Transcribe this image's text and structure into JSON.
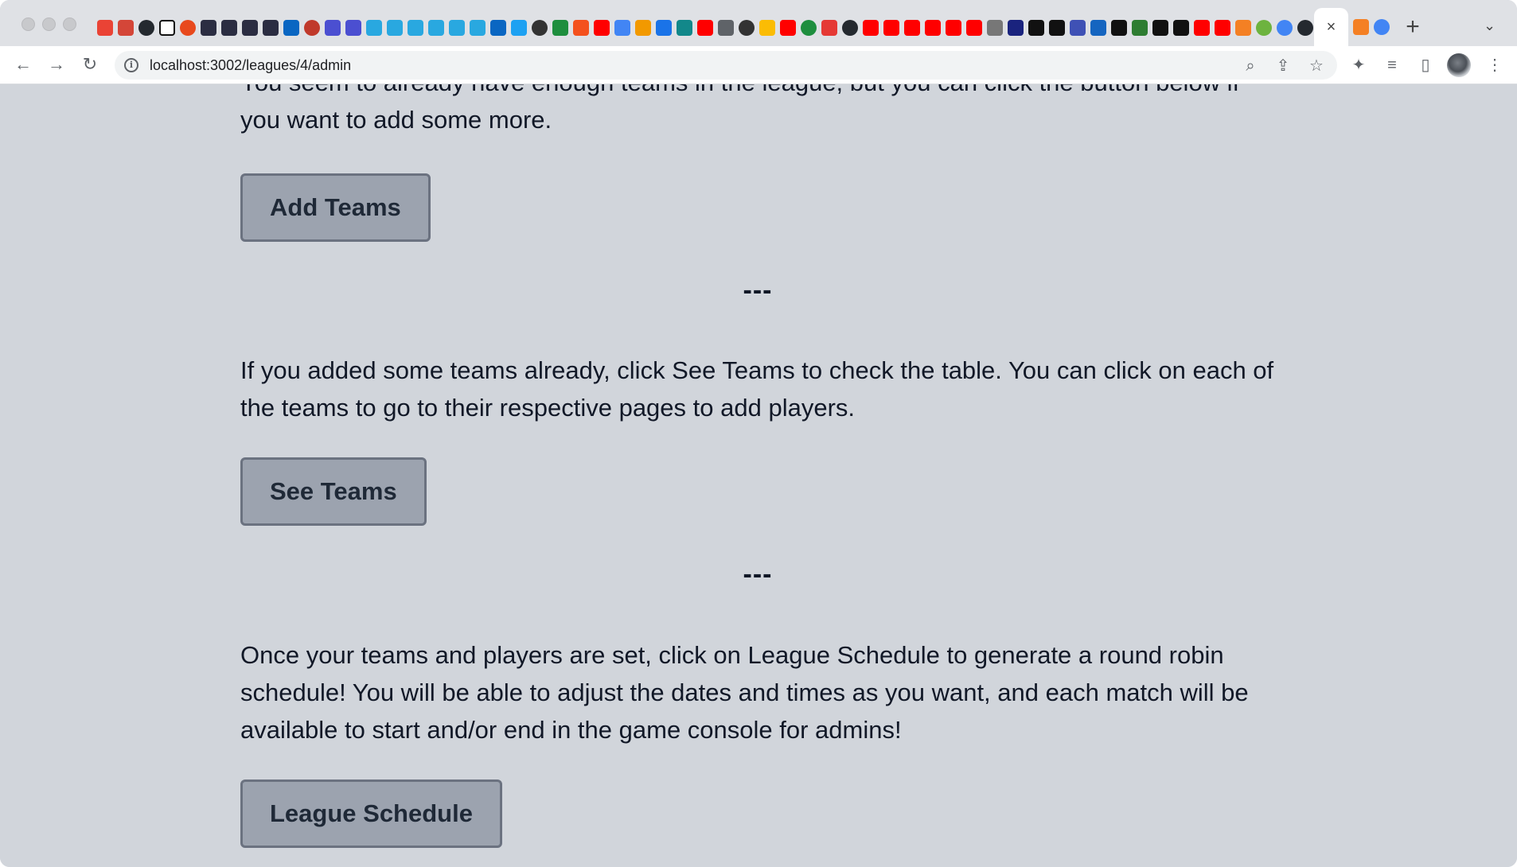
{
  "browser": {
    "url": "localhost:3002/leagues/4/admin",
    "new_tab_glyph": "+",
    "tab_close_glyph": "×",
    "tab_menu_glyph": "⌄"
  },
  "colors": {
    "page_background": "#d1d5db",
    "button_background": "#9ca3af",
    "button_border": "#6b7280",
    "button_text": "#1f2937",
    "text": "#111827"
  },
  "content": {
    "intro_text": "You seem to already have enough teams in the league, but you can click the button below if you want to add some more.",
    "add_teams_label": "Add Teams",
    "separator_1": "---",
    "see_teams_text": "If you added some teams already, click See Teams to check the table. You can click on each of the teams to go to their respective pages to add players.",
    "see_teams_label": "See Teams",
    "separator_2": "---",
    "schedule_text": "Once your teams and players are set, click on League Schedule to generate a round robin schedule! You will be able to adjust the dates and times as you want, and each match will be available to start and/or end in the game console for admins!",
    "league_schedule_label": "League Schedule"
  }
}
